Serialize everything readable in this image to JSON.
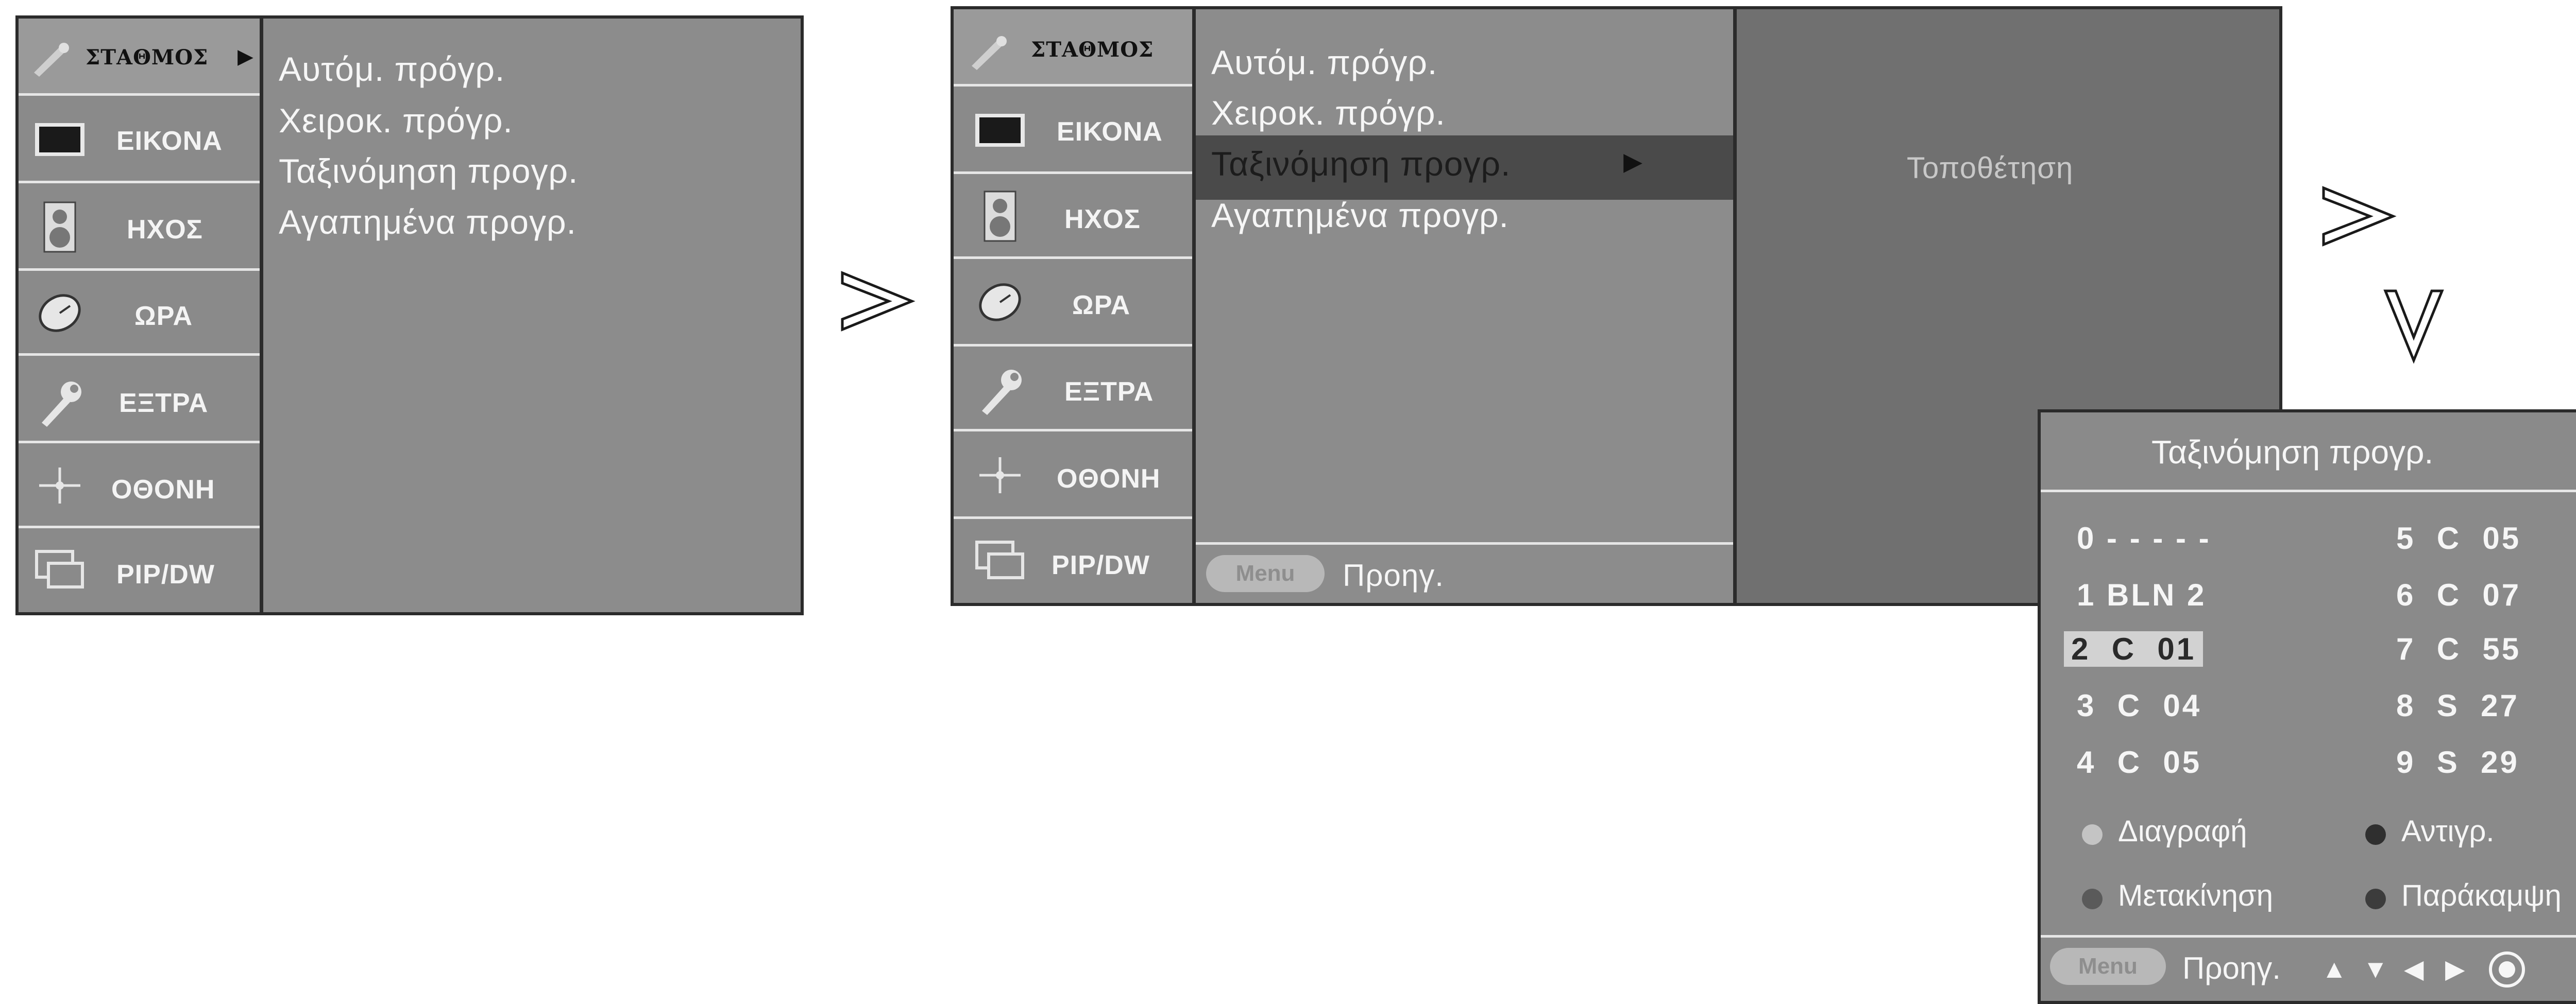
{
  "side_menu": {
    "items": [
      {
        "label": "ΣΤΑΘΜΟΣ",
        "icon": "antenna-icon"
      },
      {
        "label": "ΕΙΚΟΝΑ",
        "icon": "tv-screen-icon"
      },
      {
        "label": "ΗΧΟΣ",
        "icon": "speaker-icon"
      },
      {
        "label": "ΩΡΑ",
        "icon": "clock-icon"
      },
      {
        "label": "ΕΞΤΡΑ",
        "icon": "wrench-icon"
      },
      {
        "label": "ΟΘΟΝΗ",
        "icon": "satellite-icon"
      },
      {
        "label": "PIP/DW",
        "icon": "pip-icon"
      }
    ]
  },
  "submenu": {
    "items": [
      "Αυτόμ. πρόγρ.",
      "Χειροκ. πρόγρ.",
      "Ταξινόμηση προγρ.",
      "Αγαπημένα προγρ."
    ],
    "selected_index": 2
  },
  "submenu_arrow": "▶",
  "footer": {
    "menu_button": "Menu",
    "back_label": "Προηγ."
  },
  "side_panel": {
    "label": "Τοποθέτηση"
  },
  "sort_popup": {
    "title": "Ταξινόμηση προγρ.",
    "channels_left": [
      "0 - - - - -",
      "1 BLN 2",
      "2  C  01",
      "3  C  04",
      "4  C  05"
    ],
    "channels_right": [
      "5  C  05",
      "6  C  07",
      "7  C  55",
      "8  S  27",
      "9  S  29"
    ],
    "selected_channel": "2  C  01",
    "actions": [
      {
        "label": "Διαγραφή",
        "color": "#c4c4c4"
      },
      {
        "label": "Αντιγρ.",
        "color": "#2f2f2f"
      },
      {
        "label": "Μετακίνηση",
        "color": "#5a5a5a"
      },
      {
        "label": "Παράκαμψη",
        "color": "#3c3c3c"
      }
    ],
    "footer_menu": "Menu",
    "footer_back": "Προηγ.",
    "nav_arrows": [
      "▲",
      "▼",
      "◀",
      "▶"
    ]
  },
  "flow_arrows": [
    "right-chevron",
    "right-chevron",
    "down-chevron"
  ]
}
